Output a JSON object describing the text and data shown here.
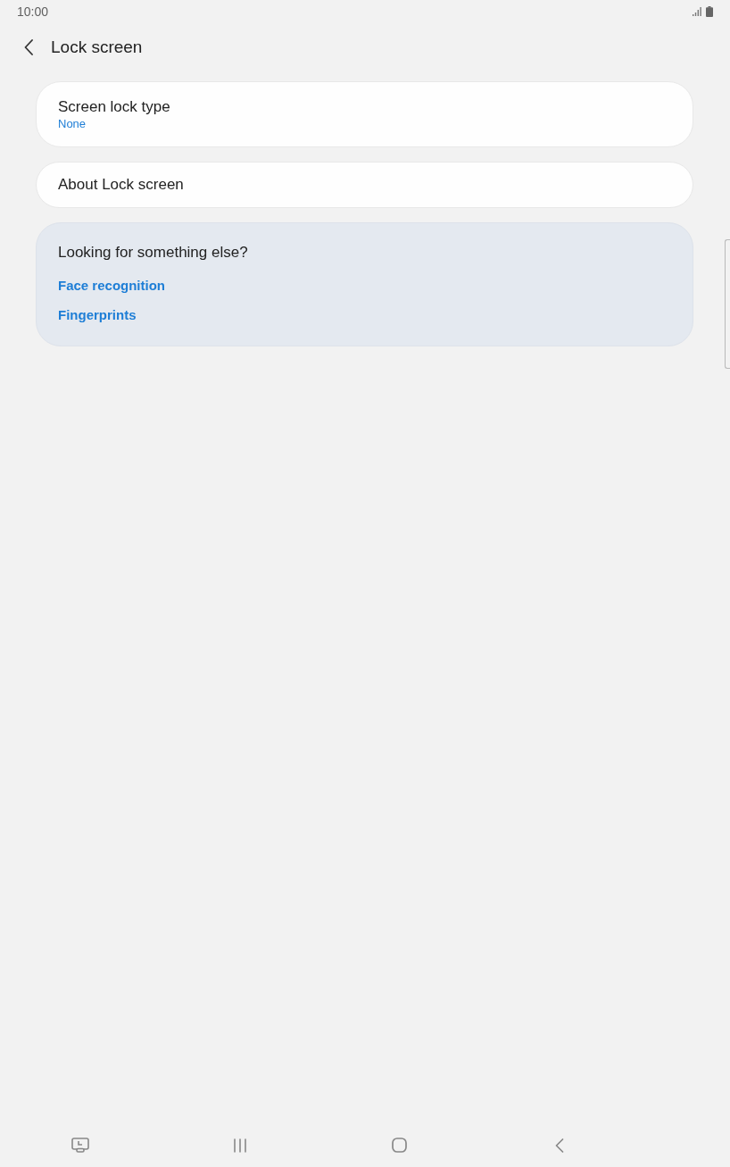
{
  "status_bar": {
    "time": "10:00"
  },
  "header": {
    "title": "Lock screen"
  },
  "settings": [
    {
      "title": "Screen lock type",
      "summary": "None"
    },
    {
      "title": "About Lock screen"
    }
  ],
  "suggestions": {
    "title": "Looking for something else?",
    "links": [
      "Face recognition",
      "Fingerprints"
    ]
  }
}
